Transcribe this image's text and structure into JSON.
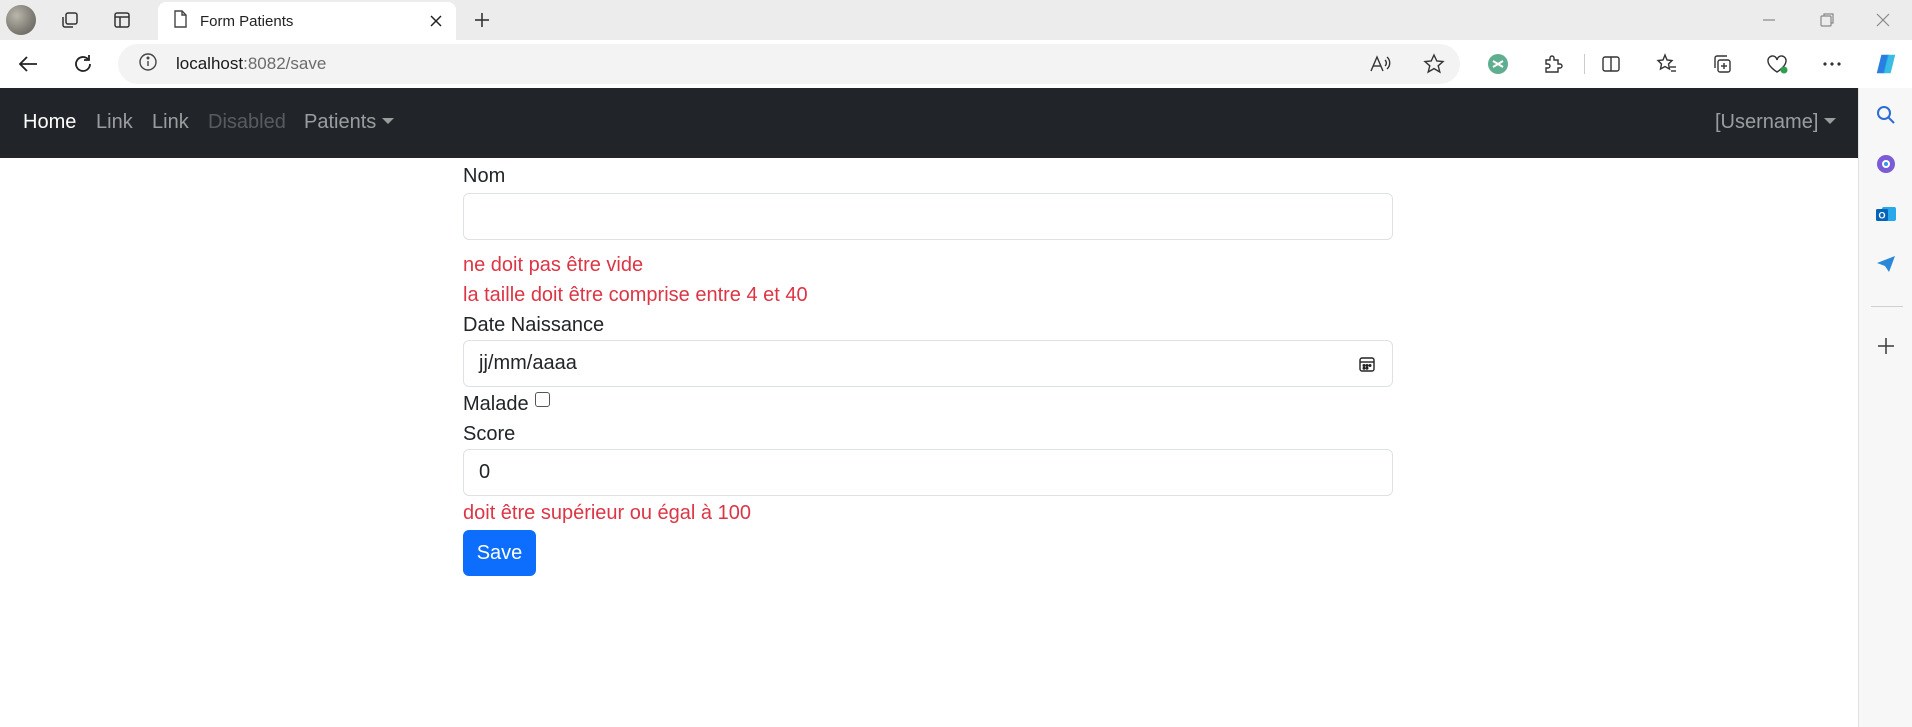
{
  "browser": {
    "tab": {
      "title": "Form Patients"
    },
    "url": {
      "host": "localhost",
      "rest": ":8082/save"
    }
  },
  "navbar": {
    "links": [
      {
        "label": "Home",
        "state": "active"
      },
      {
        "label": "Link",
        "state": "normal"
      },
      {
        "label": "Link",
        "state": "normal"
      },
      {
        "label": "Disabled",
        "state": "disabled"
      },
      {
        "label": "Patients",
        "state": "dropdown"
      }
    ],
    "user": "[Username]"
  },
  "form": {
    "nom": {
      "label": "Nom",
      "value": "",
      "errors": [
        "ne doit pas être vide",
        "la taille doit être comprise entre 4 et 40"
      ]
    },
    "date_naissance": {
      "label": "Date Naissance",
      "placeholder": "jj/mm/aaaa"
    },
    "malade": {
      "label": "Malade",
      "checked": false
    },
    "score": {
      "label": "Score",
      "value": "0",
      "errors": [
        "doit être supérieur ou égal à 100"
      ]
    },
    "save_label": "Save"
  },
  "colors": {
    "navbar_bg": "#212529",
    "error": "#dc3545",
    "primary": "#0d6efd"
  }
}
